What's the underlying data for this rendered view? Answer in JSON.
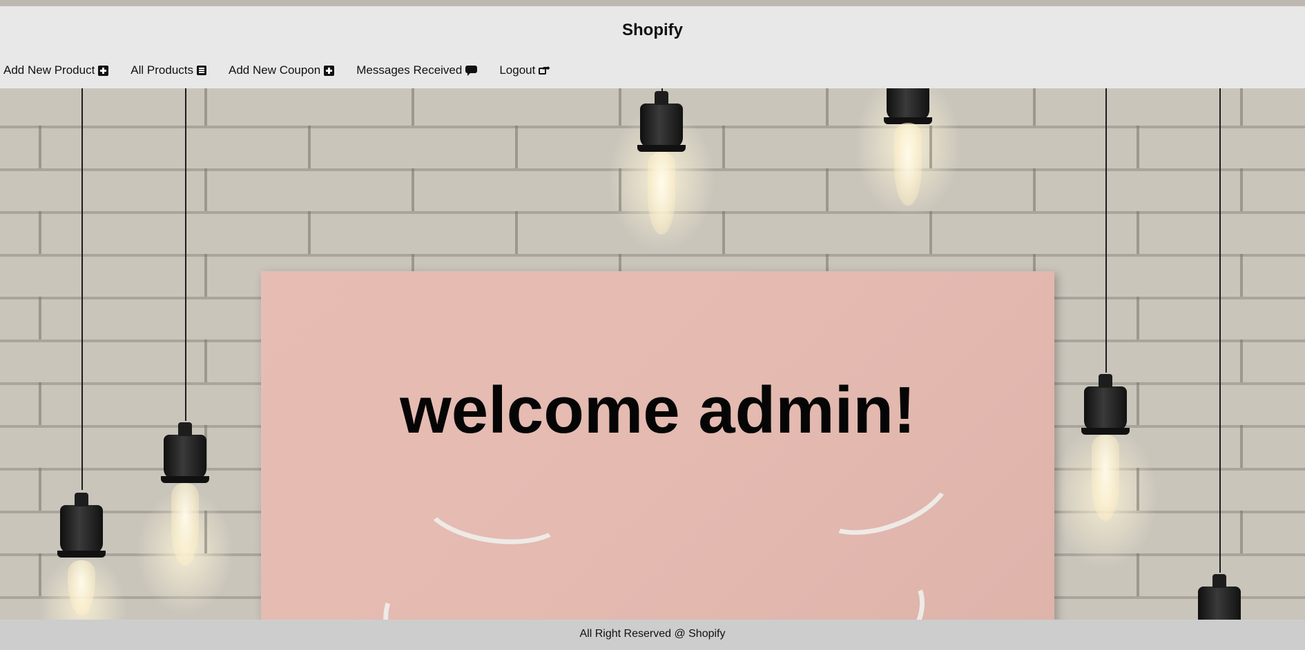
{
  "header": {
    "title": "Shopify",
    "nav": [
      {
        "label": "Add New Product",
        "icon": "plus-square-icon"
      },
      {
        "label": "All Products",
        "icon": "list-icon"
      },
      {
        "label": "Add New Coupon",
        "icon": "plus-square-icon"
      },
      {
        "label": "Messages Received",
        "icon": "comment-icon"
      },
      {
        "label": "Logout",
        "icon": "share-icon"
      }
    ]
  },
  "main": {
    "welcome": "welcome admin!"
  },
  "footer": {
    "text": "All Right Reserved @ Shopify"
  },
  "colors": {
    "header_bg": "#e8e8e8",
    "footer_bg": "#cdcdcd",
    "sign_pink": "#e4bab1"
  }
}
